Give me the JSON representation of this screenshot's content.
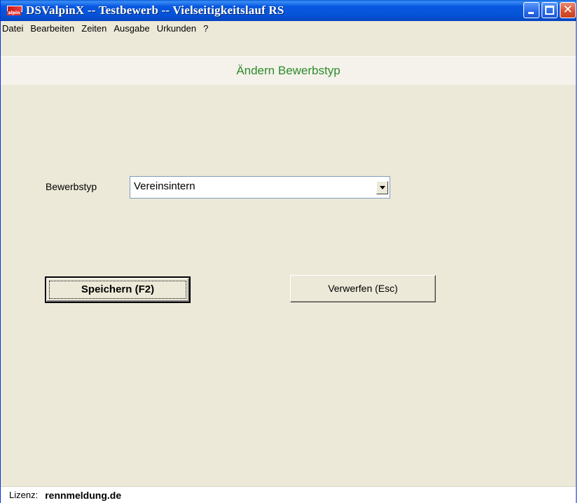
{
  "window": {
    "title": "DSValpinX -- Testbewerb -- Vielseitigkeitslauf RS",
    "icon": "dsvalpinx-app-icon",
    "icon_text": "alpin",
    "controls": [
      "minimize-icon",
      "maximize-icon",
      "close-icon"
    ],
    "close_glyph": "✕"
  },
  "menu": {
    "items": [
      {
        "label": "Datei"
      },
      {
        "label": "Bearbeiten"
      },
      {
        "label": "Zeiten"
      },
      {
        "label": "Ausgabe"
      },
      {
        "label": "Urkunden"
      },
      {
        "label": "?"
      }
    ]
  },
  "page": {
    "title": "Ändern Bewerbstyp",
    "title_color": "#2e8b2e"
  },
  "form": {
    "bewerbstyp": {
      "label": "Bewerbstyp",
      "value": "Vereinsintern"
    }
  },
  "buttons": {
    "save_label": "Speichern (F2)",
    "discard_label": "Verwerfen (Esc)"
  },
  "status": {
    "license_label": "Lizenz:",
    "license_value": "rennmeldung.de"
  },
  "colors": {
    "titlebar": "#0554d8",
    "window_bg": "#ece9d8",
    "close_button": "#d8502e"
  }
}
